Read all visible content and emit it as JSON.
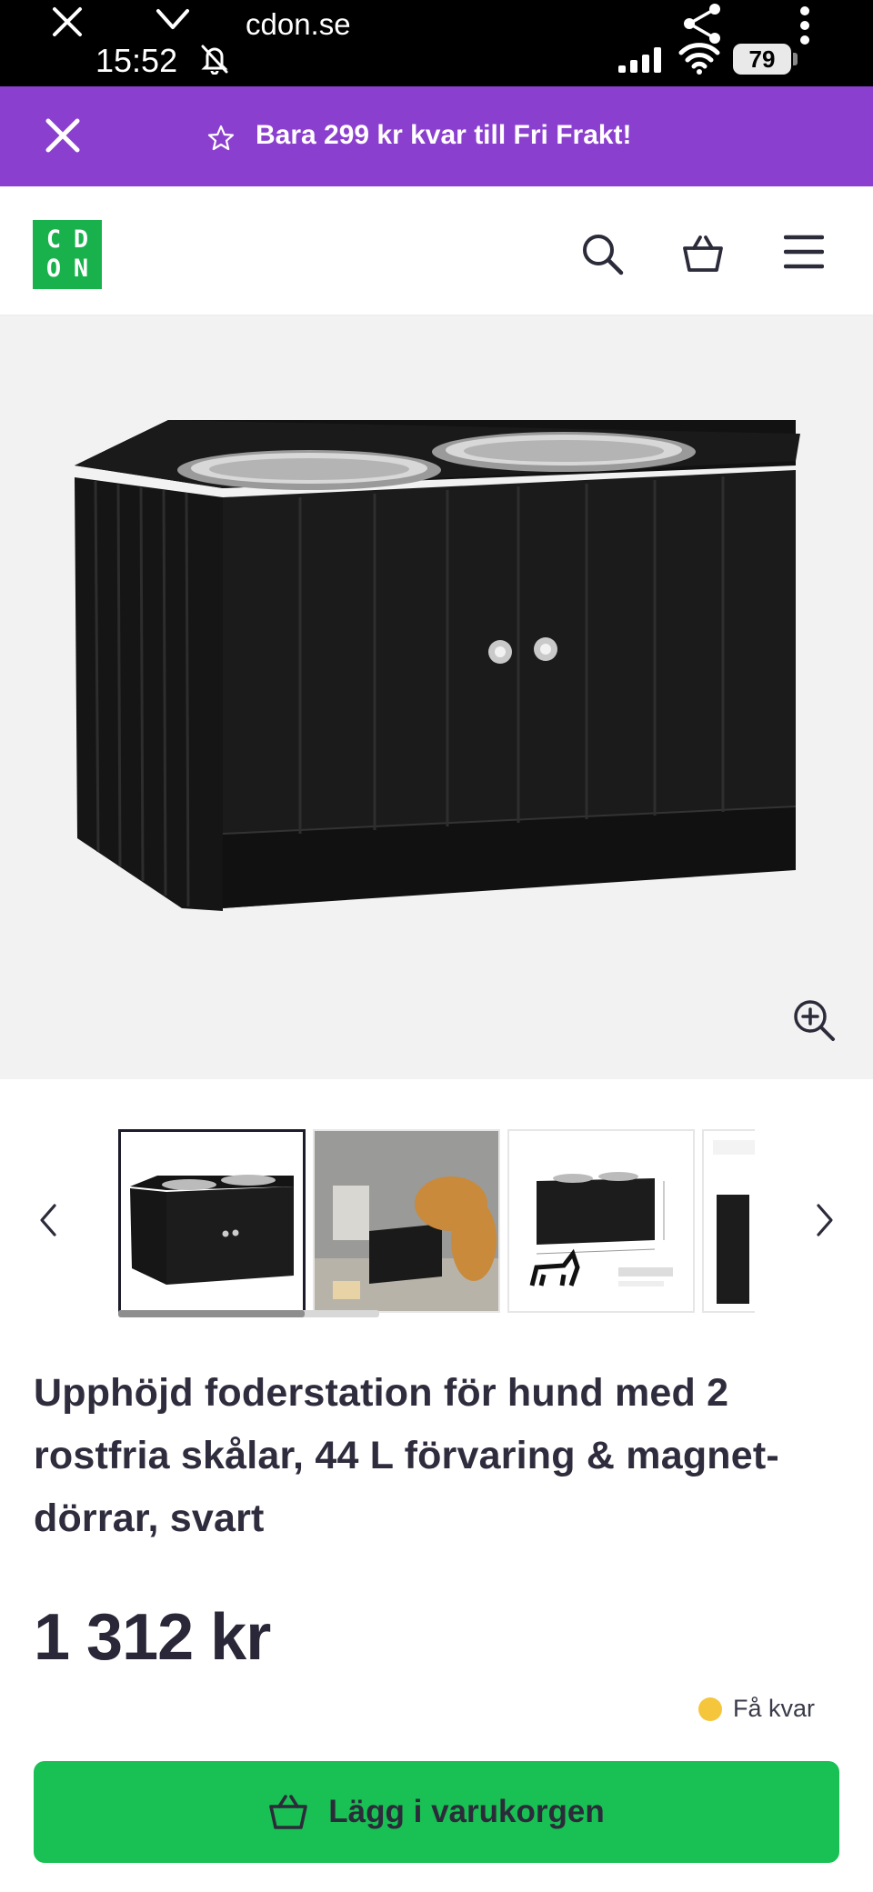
{
  "status_bar": {
    "url": "cdon.se",
    "time": "15:52",
    "battery": "79"
  },
  "promo": {
    "text": "Bara 299 kr kvar till Fri Frakt!",
    "accent_color": "#8b3fce"
  },
  "header": {
    "logo_letters": [
      "C",
      "D",
      "O",
      "N"
    ],
    "brand_color": "#19b14c"
  },
  "gallery": {
    "thumbnail_count": 4,
    "active_index": 0
  },
  "product": {
    "title": "Upphöjd foderstation för hund med 2 rostfria skålar, 44 L förvaring & magnet-dörrar, svart",
    "price": "1 312 kr",
    "stock_label": "Få kvar",
    "stock_color": "#f5c53c"
  },
  "cta": {
    "label": "Lägg i varukorgen",
    "color": "#19c053"
  }
}
